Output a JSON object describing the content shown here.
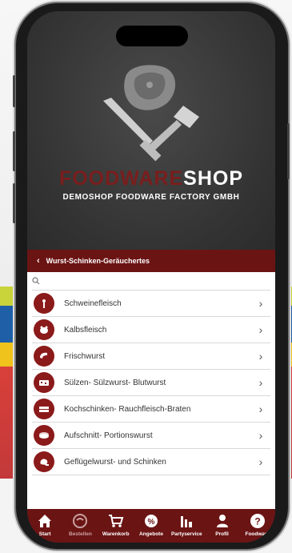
{
  "brand": {
    "name_part1": "FOODWARE",
    "name_part2": "SHOP",
    "subtitle": "DEMOSHOP FOODWARE FACTORY GMBH"
  },
  "breadcrumb": {
    "label": "Wurst-Schinken-Geräuchertes"
  },
  "search": {
    "placeholder": ""
  },
  "categories": [
    {
      "label": "Schweinefleisch",
      "icon": "pig-icon"
    },
    {
      "label": "Kalbsfleisch",
      "icon": "calf-icon"
    },
    {
      "label": "Frischwurst",
      "icon": "sausage-icon"
    },
    {
      "label": "Sülzen- Sülzwurst- Blutwurst",
      "icon": "aspic-icon"
    },
    {
      "label": "Kochschinken- Rauchfleisch-Braten",
      "icon": "ham-icon"
    },
    {
      "label": "Aufschnitt- Portionswurst",
      "icon": "coldcuts-icon"
    },
    {
      "label": "Geflügelwurst- und Schinken",
      "icon": "poultry-icon"
    }
  ],
  "tabs": [
    {
      "label": "Start",
      "icon": "home-icon"
    },
    {
      "label": "Bestellen",
      "icon": "order-icon"
    },
    {
      "label": "Warenkorb",
      "icon": "cart-icon"
    },
    {
      "label": "Angebote",
      "icon": "offers-icon"
    },
    {
      "label": "Partyservice",
      "icon": "party-icon"
    },
    {
      "label": "Profil",
      "icon": "profile-icon"
    },
    {
      "label": "Foodware",
      "icon": "help-icon"
    }
  ],
  "colors": {
    "accent": "#6b1414",
    "icon_bg": "#8b1a1a",
    "header_bg": "#333333"
  }
}
